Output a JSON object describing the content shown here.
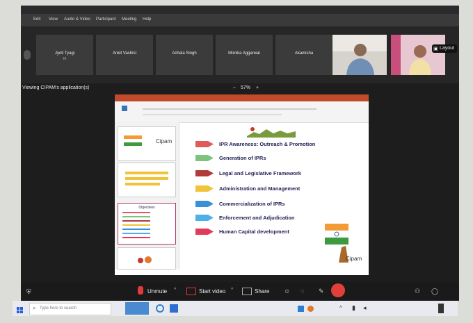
{
  "window": {
    "menu_items": [
      "Edit",
      "View",
      "Audio & Video",
      "Participant",
      "Meeting",
      "Help"
    ]
  },
  "participants": [
    {
      "name": "Jyoti Tyagi",
      "sub": "Hi"
    },
    {
      "name": "Ankit Vashist",
      "sub": ""
    },
    {
      "name": "Achala Singh",
      "sub": ""
    },
    {
      "name": "Monika Aggarwal",
      "sub": ""
    },
    {
      "name": "Akanksha",
      "sub": ""
    }
  ],
  "layout_button": "Layout",
  "status": {
    "viewing_text": "Viewing CIPAM's application(s)",
    "zoom": "57%"
  },
  "presentation": {
    "slide_items": [
      {
        "label": "IPR Awareness: Outreach & Promotion",
        "color": "#e05a5a"
      },
      {
        "label": "Generation of IPRs",
        "color": "#7cc47c"
      },
      {
        "label": "Legal and Legislative Framework",
        "color": "#b13a3a"
      },
      {
        "label": "Administration and Management",
        "color": "#f0c33a"
      },
      {
        "label": "Commercialization of IPRs",
        "color": "#3a90d8"
      },
      {
        "label": "Enforcement and Adjudication",
        "color": "#4fb0e8"
      },
      {
        "label": "Human Capital development",
        "color": "#e03c5a"
      }
    ],
    "logo_text": "Cipam",
    "thumb_logo_text": "Cipam",
    "thumb_title": "Objectives"
  },
  "toolbar": {
    "unmute": "Unmute",
    "start_video": "Start video",
    "share": "Share"
  },
  "taskbar": {
    "search_placeholder": "Type here to search"
  }
}
